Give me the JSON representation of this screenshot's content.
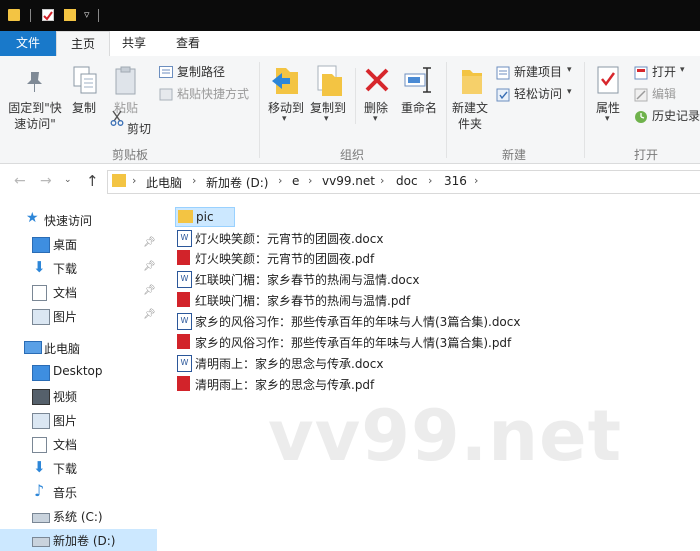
{
  "tabs": {
    "file": "文件",
    "home": "主页",
    "share": "共享",
    "view": "查看"
  },
  "ribbon": {
    "pin_quick_access": "固定到\"快速访问\"",
    "copy": "复制",
    "paste": "粘贴",
    "copy_path": "复制路径",
    "paste_shortcut": "粘贴快捷方式",
    "cut": "剪切",
    "group_clipboard": "剪贴板",
    "move_to": "移动到",
    "copy_to": "复制到",
    "delete": "删除",
    "rename": "重命名",
    "group_organize": "组织",
    "new_folder": "新建文件夹",
    "new_item": "新建项目",
    "easy_access": "轻松访问",
    "group_new": "新建",
    "properties": "属性",
    "open": "打开",
    "edit": "编辑",
    "history": "历史记录",
    "group_open": "打开"
  },
  "breadcrumb": [
    "此电脑",
    "新加卷 (D:)",
    "e",
    "vv99.net",
    "doc",
    "316"
  ],
  "nav": {
    "quick_access": "快速访问",
    "quick_items": [
      "桌面",
      "下载",
      "文档",
      "图片"
    ],
    "this_pc": "此电脑",
    "pc_items": [
      "Desktop",
      "视频",
      "图片",
      "文档",
      "下载",
      "音乐",
      "系统 (C:)",
      "新加卷 (D:)"
    ]
  },
  "files": [
    {
      "name": "pic",
      "type": "folder"
    },
    {
      "name": "灯火映笑颜：元宵节的团圆夜.docx",
      "type": "docx"
    },
    {
      "name": "灯火映笑颜：元宵节的团圆夜.pdf",
      "type": "pdf"
    },
    {
      "name": "红联映门楣：家乡春节的热闹与温情.docx",
      "type": "docx"
    },
    {
      "name": "红联映门楣：家乡春节的热闹与温情.pdf",
      "type": "pdf"
    },
    {
      "name": "家乡的风俗习作：那些传承百年的年味与人情(3篇合集).docx",
      "type": "docx"
    },
    {
      "name": "家乡的风俗习作：那些传承百年的年味与人情(3篇合集).pdf",
      "type": "pdf"
    },
    {
      "name": "清明雨上：家乡的思念与传承.docx",
      "type": "docx"
    },
    {
      "name": "清明雨上：家乡的思念与传承.pdf",
      "type": "pdf"
    }
  ],
  "watermark": "vv99.net",
  "colors": {
    "accent": "#1979ca",
    "folder": "#f6c94a",
    "pdf": "#d2232a",
    "word": "#2b579a"
  }
}
